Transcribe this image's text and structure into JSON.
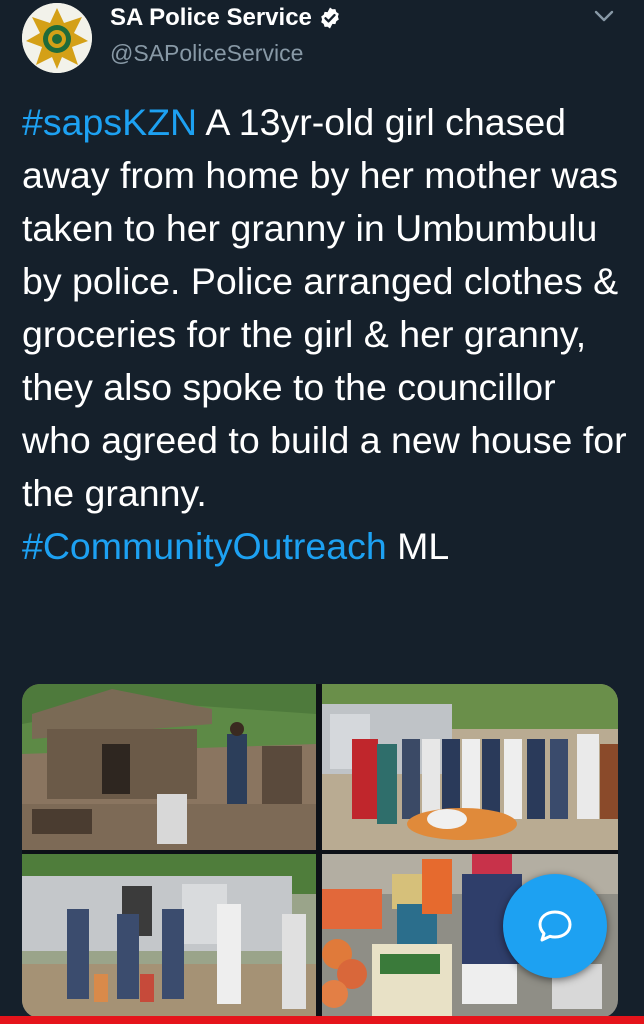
{
  "account": {
    "name": "SA Police Service",
    "handle": "@SAPoliceService"
  },
  "tweet": {
    "hashtag1": "#sapsKZN",
    "body": " A 13yr-old girl chased away from home by her mother was taken to her granny in Umbumbulu by police. Police arranged clothes & groceries for the girl & her granny, they also spoke to the councillor who agreed to build a new house for the granny.",
    "hashtag2": "#CommunityOutreach",
    "signoff": " ML"
  },
  "colors": {
    "background": "#15202b",
    "accent": "#1da1f2",
    "secondary_text": "#8899a6",
    "bottom_bar": "#e5141b"
  },
  "icons": {
    "verified": "verified-badge-icon",
    "menu": "chevron-down-icon",
    "compose": "message-bubble-icon"
  }
}
